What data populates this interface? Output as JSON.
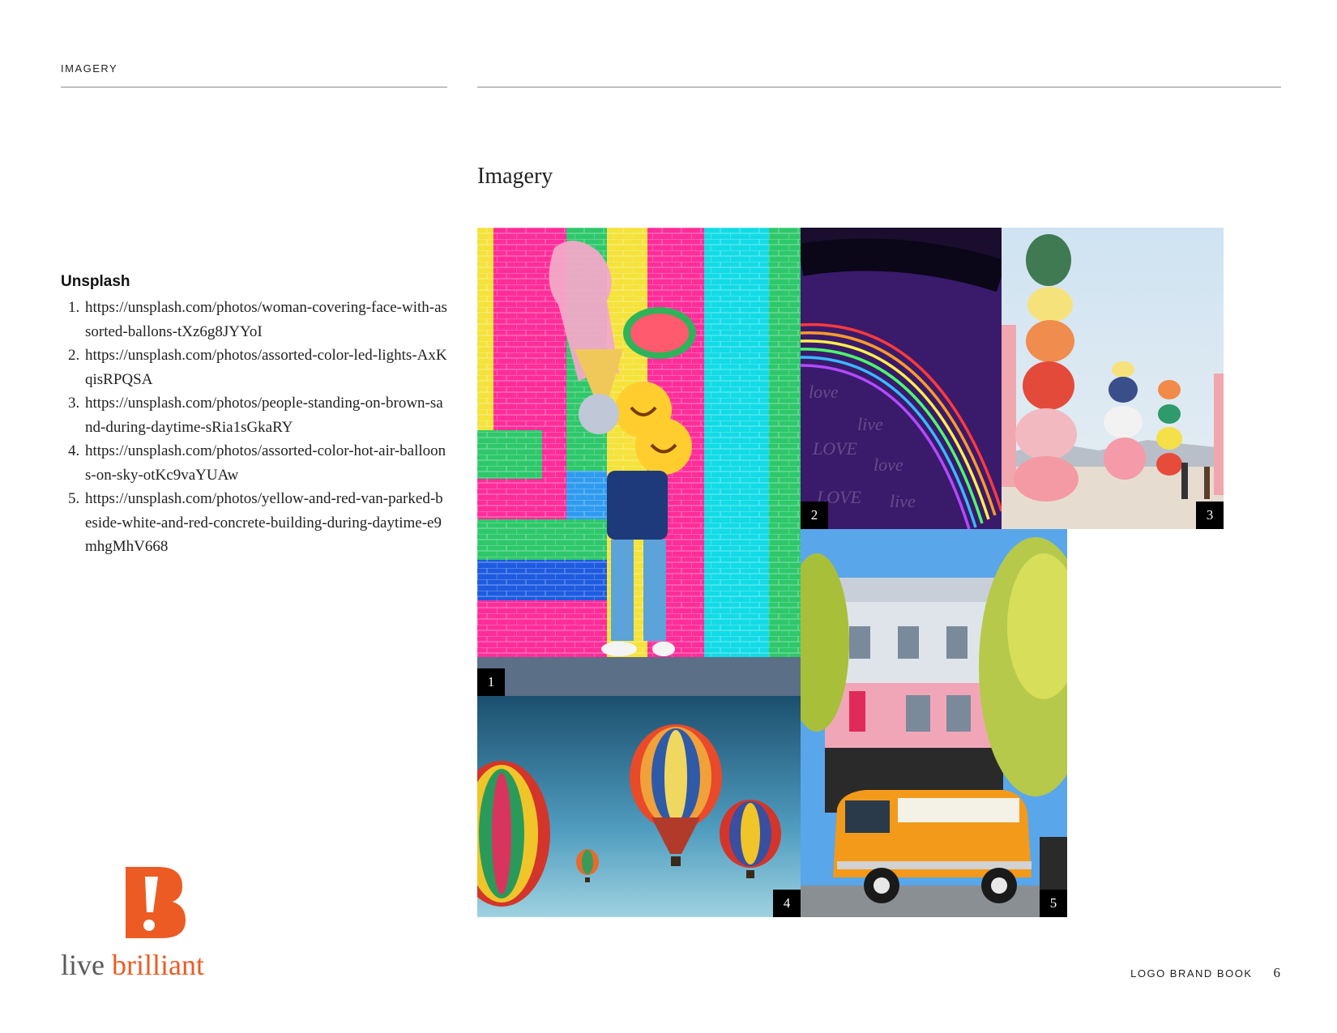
{
  "header": {
    "section_label": "IMAGERY"
  },
  "main": {
    "title": "Imagery"
  },
  "sources": {
    "heading": "Unsplash",
    "items": [
      "https://unsplash.com/photos/woman-covering-face-with-assorted-ballons-tXz6g8JYYoI",
      "https://unsplash.com/photos/assorted-color-led-lights-AxKqisRPQSA",
      "https://unsplash.com/photos/people-standing-on-brown-sand-during-daytime-sRia1sGkaRY",
      "https://unsplash.com/photos/assorted-color-hot-air-balloons-on-sky-otKc9vaYUAw",
      "https://unsplash.com/photos/yellow-and-red-van-parked-beside-white-and-red-concrete-building-during-daytime-e9mhgMhV668"
    ]
  },
  "photos": [
    {
      "number": "1",
      "subject": "woman with balloons in front of a colorful brick wall"
    },
    {
      "number": "2",
      "subject": "neon rainbow on a love graffiti wall"
    },
    {
      "number": "3",
      "subject": "colorful stacked rocks in the desert"
    },
    {
      "number": "4",
      "subject": "hot air balloons in the sky"
    },
    {
      "number": "5",
      "subject": "orange van parked beside a building"
    }
  ],
  "logo": {
    "word1": "live",
    "word2": "brilliant",
    "mark_letter": "B",
    "mark_symbol": "!"
  },
  "footer": {
    "label": "LOGO BRAND BOOK",
    "page_number": "6"
  },
  "colors": {
    "brand_orange": "#ec5b24",
    "brand_gray": "#5a5a5a",
    "rule": "#8a8a8a"
  }
}
